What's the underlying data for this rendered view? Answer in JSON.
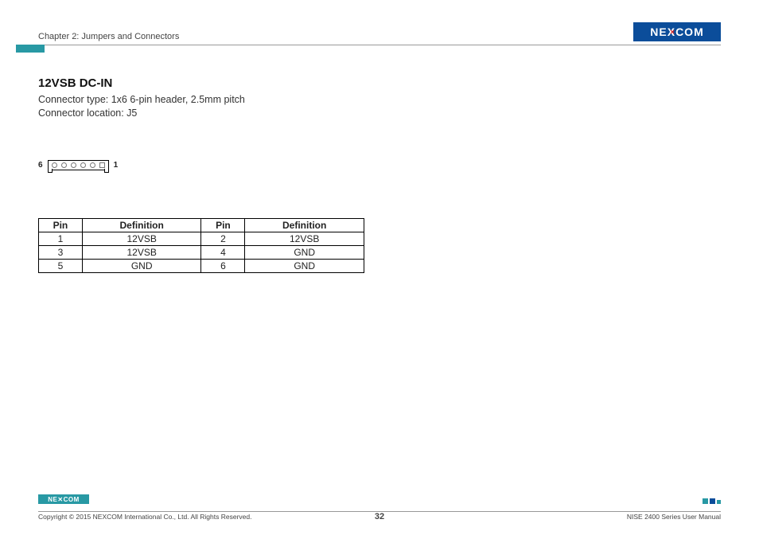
{
  "header": {
    "chapter": "Chapter 2: Jumpers and Connectors",
    "brand": "NEXCOM"
  },
  "section": {
    "title": "12VSB DC-IN",
    "connector_type": "Connector type: 1x6 6-pin header, 2.5mm pitch",
    "connector_location": "Connector location: J5"
  },
  "diagram": {
    "left_label": "6",
    "right_label": "1"
  },
  "table": {
    "headers": {
      "pin": "Pin",
      "definition": "Definition"
    },
    "rows": [
      {
        "p1": "1",
        "d1": "12VSB",
        "p2": "2",
        "d2": "12VSB"
      },
      {
        "p1": "3",
        "d1": "12VSB",
        "p2": "4",
        "d2": "GND"
      },
      {
        "p1": "5",
        "d1": "GND",
        "p2": "6",
        "d2": "GND"
      }
    ]
  },
  "footer": {
    "brand": "NEXCOM",
    "copyright": "Copyright © 2015 NEXCOM International Co., Ltd. All Rights Reserved.",
    "page": "32",
    "manual": "NISE 2400 Series User Manual"
  }
}
